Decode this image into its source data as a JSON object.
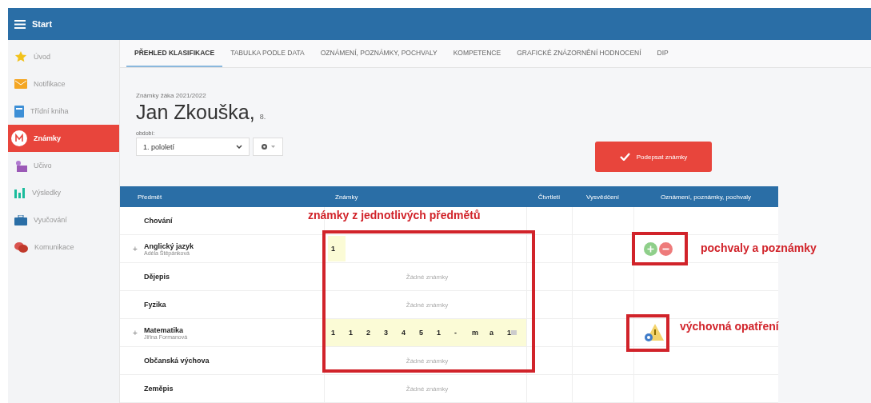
{
  "topbar": {
    "title": "Start"
  },
  "sidebar": {
    "items": [
      {
        "label": "Úvod",
        "kind": "star",
        "selected": false
      },
      {
        "label": "Notifikace",
        "kind": "mail",
        "selected": false
      },
      {
        "label": "Třídní kniha",
        "kind": "book",
        "selected": false
      },
      {
        "label": "Známky",
        "kind": "grades",
        "selected": true
      },
      {
        "label": "Učivo",
        "kind": "people",
        "selected": false
      },
      {
        "label": "Výsledky",
        "kind": "chart",
        "selected": false
      },
      {
        "label": "Vyučování",
        "kind": "case",
        "selected": false
      },
      {
        "label": "Komunikace",
        "kind": "chat",
        "selected": false
      }
    ]
  },
  "tabs": [
    {
      "label": "PŘEHLED KLASIFIKACE",
      "selected": true
    },
    {
      "label": "TABULKA PODLE DATA",
      "selected": false
    },
    {
      "label": "OZNÁMENÍ, POZNÁMKY, POCHVALY",
      "selected": false
    },
    {
      "label": "KOMPETENCE",
      "selected": false
    },
    {
      "label": "GRAFICKÉ ZNÁZORNĚNÍ HODNOCENÍ",
      "selected": false
    },
    {
      "label": "DIP",
      "selected": false
    }
  ],
  "header": {
    "caption": "Známky žáka 2021/2022",
    "name": "Jan Zkouška,",
    "class": "8."
  },
  "period": {
    "label": "období:",
    "value": "1. pololetí"
  },
  "sign_button": "Podepsat známky",
  "table": {
    "columns": [
      "Předmět",
      "Známky",
      "Čtvrtletí",
      "Vysvědčení",
      "Oznámení, poznámky, pochvaly"
    ],
    "rows": [
      {
        "kind": "plain",
        "subject": "Chování",
        "grades": []
      },
      {
        "kind": "notes",
        "expander": "+",
        "subject": "Anglický jazyk",
        "teacher": "Adéla Štěpánková",
        "grades": [
          "1"
        ]
      },
      {
        "kind": "plain",
        "subject": "Dějepis",
        "grades": [],
        "empty": "Žádné známky"
      },
      {
        "kind": "plain",
        "subject": "Fyzika",
        "grades": [],
        "empty": "Žádné známky"
      },
      {
        "kind": "measure",
        "expander": "+",
        "subject": "Matematika",
        "teacher": "Jiřina Formanová",
        "grades": [
          "1",
          "1",
          "2",
          "3",
          "4",
          "5",
          "1",
          "-",
          "m",
          "a",
          "1"
        ]
      },
      {
        "kind": "plain",
        "subject": "Občanská výchova",
        "grades": [],
        "empty": "Žádné známky"
      },
      {
        "kind": "plain",
        "subject": "Zeměpis",
        "grades": [],
        "empty": "Žádné známky"
      }
    ]
  },
  "annotations": [
    {
      "kind": "grades",
      "text": "známky z jednotlivých předmětů"
    },
    {
      "kind": "notes",
      "text": "pochvaly a poznámky"
    },
    {
      "kind": "measures",
      "text": "výchovná opatření"
    }
  ]
}
